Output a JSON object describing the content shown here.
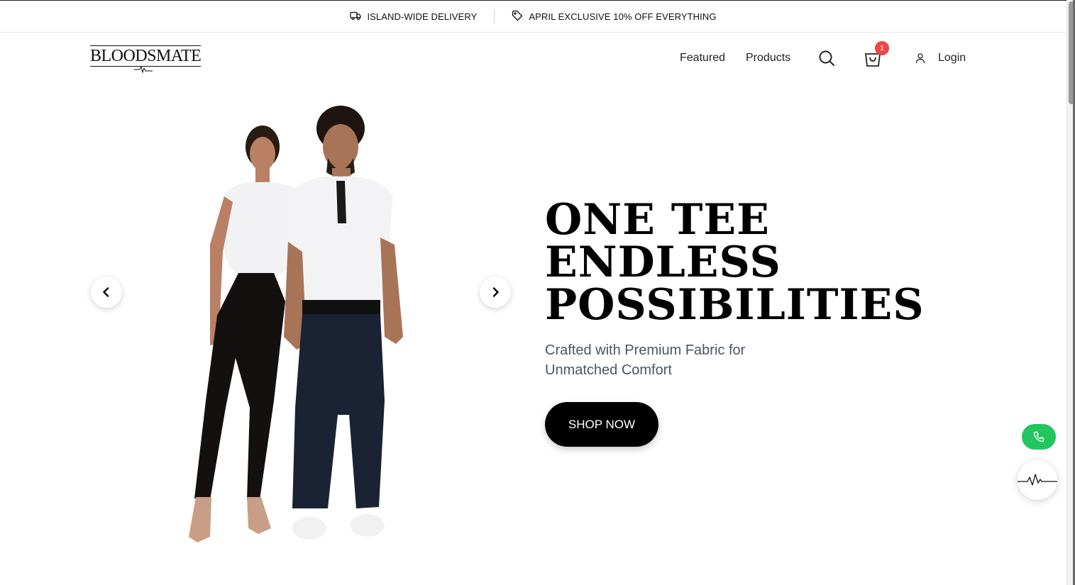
{
  "promo_bar": {
    "delivery_text": "ISLAND-WIDE DELIVERY",
    "offer_text": "APRIL EXCLUSIVE 10% OFF EVERYTHING",
    "delivery_icon": "truck-icon",
    "offer_icon": "tag-icon"
  },
  "header": {
    "logo_text": "BLOODSMATE",
    "nav": [
      {
        "label": "Featured"
      },
      {
        "label": "Products"
      }
    ],
    "search_icon": "search-icon",
    "cart": {
      "icon": "shopping-bag-icon",
      "count": "1"
    },
    "login": {
      "icon": "user-icon",
      "label": "Login"
    }
  },
  "hero": {
    "title_lines": [
      "ONE TEE",
      "ENDLESS",
      "POSSIBILITIES"
    ],
    "subtitle_lines": [
      "Crafted with Premium Fabric for",
      "Unmatched Comfort"
    ],
    "cta_label": "SHOP NOW",
    "prev_icon": "chevron-left-icon",
    "next_icon": "chevron-right-icon"
  },
  "widgets": {
    "phone_icon": "phone-icon",
    "pulse_icon": "heartbeat-icon"
  },
  "colors": {
    "accent_green": "#22c55e",
    "badge_red": "#ef4444",
    "cta_black": "#000000",
    "subtitle_gray": "#4b5563"
  }
}
